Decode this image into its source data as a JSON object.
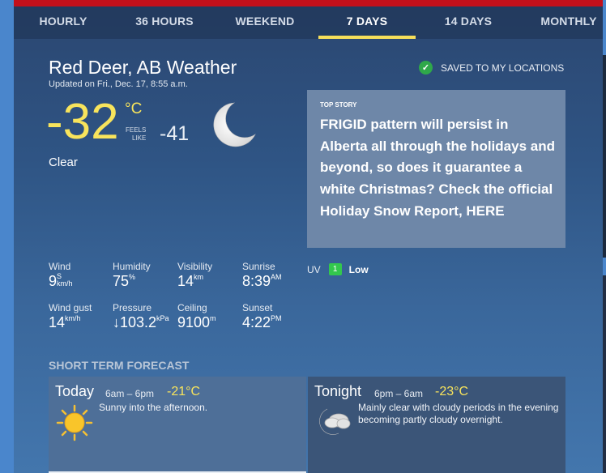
{
  "tabs": [
    "HOURLY",
    "36 HOURS",
    "WEEKEND",
    "7 DAYS",
    "14 DAYS",
    "MONTHLY"
  ],
  "active_tab": "7 DAYS",
  "location": {
    "title": "Red Deer, AB Weather",
    "updated": "Updated on Fri., Dec. 17, 8:55 a.m."
  },
  "saved": {
    "label": "SAVED TO MY LOCATIONS"
  },
  "current": {
    "temp": "-32",
    "unit": "°C",
    "feels_label_1": "FEELS",
    "feels_label_2": "LIKE",
    "feels_value": "-41",
    "condition": "Clear",
    "icon": "moon-icon"
  },
  "top_story": {
    "label": "TOP STORY",
    "text": "FRIGID pattern will persist in Alberta all through the holidays and beyond, so does it guarantee a white Christmas? Check the official Holiday Snow Report, HERE"
  },
  "stats": {
    "wind": {
      "label": "Wind",
      "value": "9",
      "dir": "S",
      "unit": "km/h"
    },
    "humidity": {
      "label": "Humidity",
      "value": "75",
      "unit": "%"
    },
    "visibility": {
      "label": "Visibility",
      "value": "14",
      "unit": "km"
    },
    "sunrise": {
      "label": "Sunrise",
      "value": "8:39",
      "unit": "AM"
    },
    "gust": {
      "label": "Wind gust",
      "value": "14",
      "unit": "km/h"
    },
    "pressure": {
      "label": "Pressure",
      "value": "↓103.2",
      "unit": "kPa"
    },
    "ceiling": {
      "label": "Ceiling",
      "value": "9100",
      "unit": "m"
    },
    "sunset": {
      "label": "Sunset",
      "value": "4:22",
      "unit": "PM"
    }
  },
  "uv": {
    "label": "UV",
    "index": "1",
    "level": "Low"
  },
  "short_term": {
    "title": "SHORT TERM FORECAST",
    "periods": [
      {
        "name": "Today",
        "hours": "6am – 6pm",
        "temp": "-21°C",
        "desc": "Sunny into the afternoon.",
        "icon": "sun-icon"
      },
      {
        "name": "Tonight",
        "hours": "6pm – 6am",
        "temp": "-23°C",
        "desc": "Mainly clear with cloudy periods in the evening becoming partly cloudy overnight.",
        "icon": "moon-cloud-icon"
      }
    ]
  },
  "colors": {
    "accent": "#f8e45c",
    "brand_red": "#c4101b",
    "uv_green": "#33c74d"
  }
}
